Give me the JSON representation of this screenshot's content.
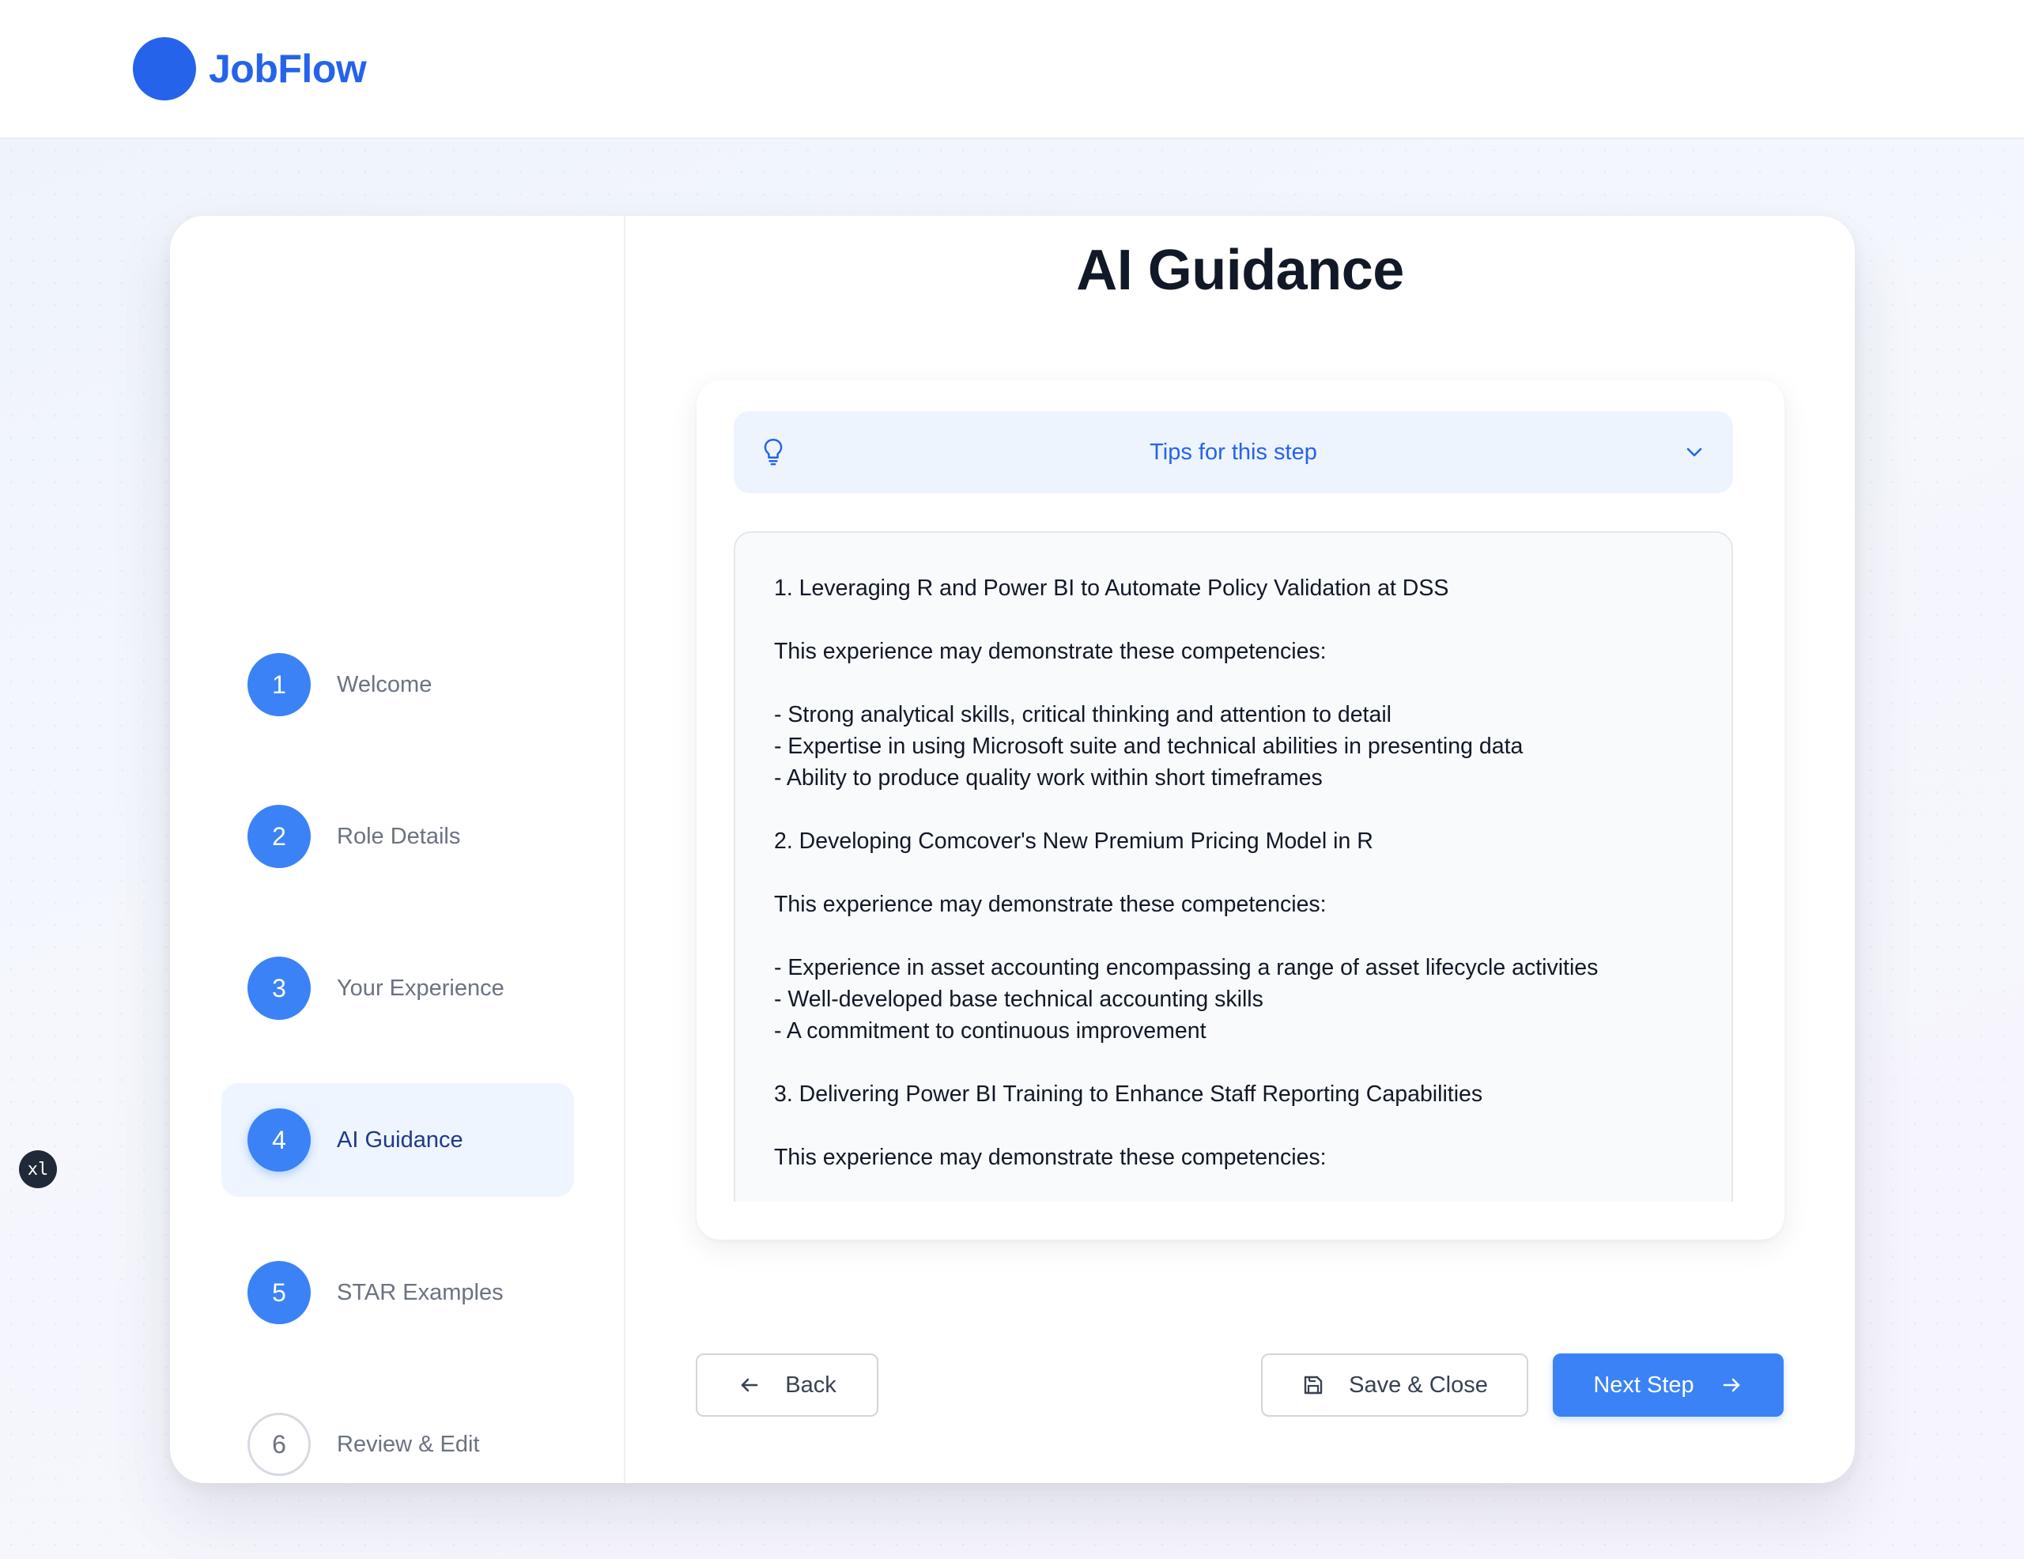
{
  "header": {
    "brand": "JobFlow"
  },
  "sidebar": {
    "steps": [
      {
        "number": "1",
        "label": "Welcome",
        "state": "complete"
      },
      {
        "number": "2",
        "label": "Role Details",
        "state": "complete"
      },
      {
        "number": "3",
        "label": "Your Experience",
        "state": "complete"
      },
      {
        "number": "4",
        "label": "AI Guidance",
        "state": "active"
      },
      {
        "number": "5",
        "label": "STAR Examples",
        "state": "complete"
      },
      {
        "number": "6",
        "label": "Review & Edit",
        "state": "pending"
      }
    ]
  },
  "main": {
    "title": "AI Guidance",
    "tips": {
      "label": "Tips for this step",
      "icon": "lightbulb-icon",
      "toggle_icon": "chevron-down-icon"
    },
    "guidance_lines": [
      "1. Leveraging R and Power BI to Automate Policy Validation at DSS",
      "",
      "This experience may demonstrate these competencies:",
      "",
      "- Strong analytical skills, critical thinking and attention to detail",
      "- Expertise in using Microsoft suite and technical abilities in presenting data",
      "- Ability to produce quality work within short timeframes",
      "",
      "2. Developing Comcover's New Premium Pricing Model in R",
      "",
      "This experience may demonstrate these competencies:",
      "",
      "- Experience in asset accounting encompassing a range of asset lifecycle activities",
      "- Well-developed base technical accounting skills",
      "- A commitment to continuous improvement",
      "",
      "3. Delivering Power BI Training to Enhance Staff Reporting Capabilities",
      "",
      "This experience may demonstrate these competencies:"
    ]
  },
  "footer": {
    "back_label": "Back",
    "save_label": "Save & Close",
    "next_label": "Next Step"
  },
  "overlay_badge": "xl",
  "colors": {
    "brand": "#2563eb",
    "step_complete": "#3b82f6",
    "active_step_bg": "#eef5ff",
    "tips_bg": "#edf4fe",
    "primary_button": "#3b82f6"
  }
}
